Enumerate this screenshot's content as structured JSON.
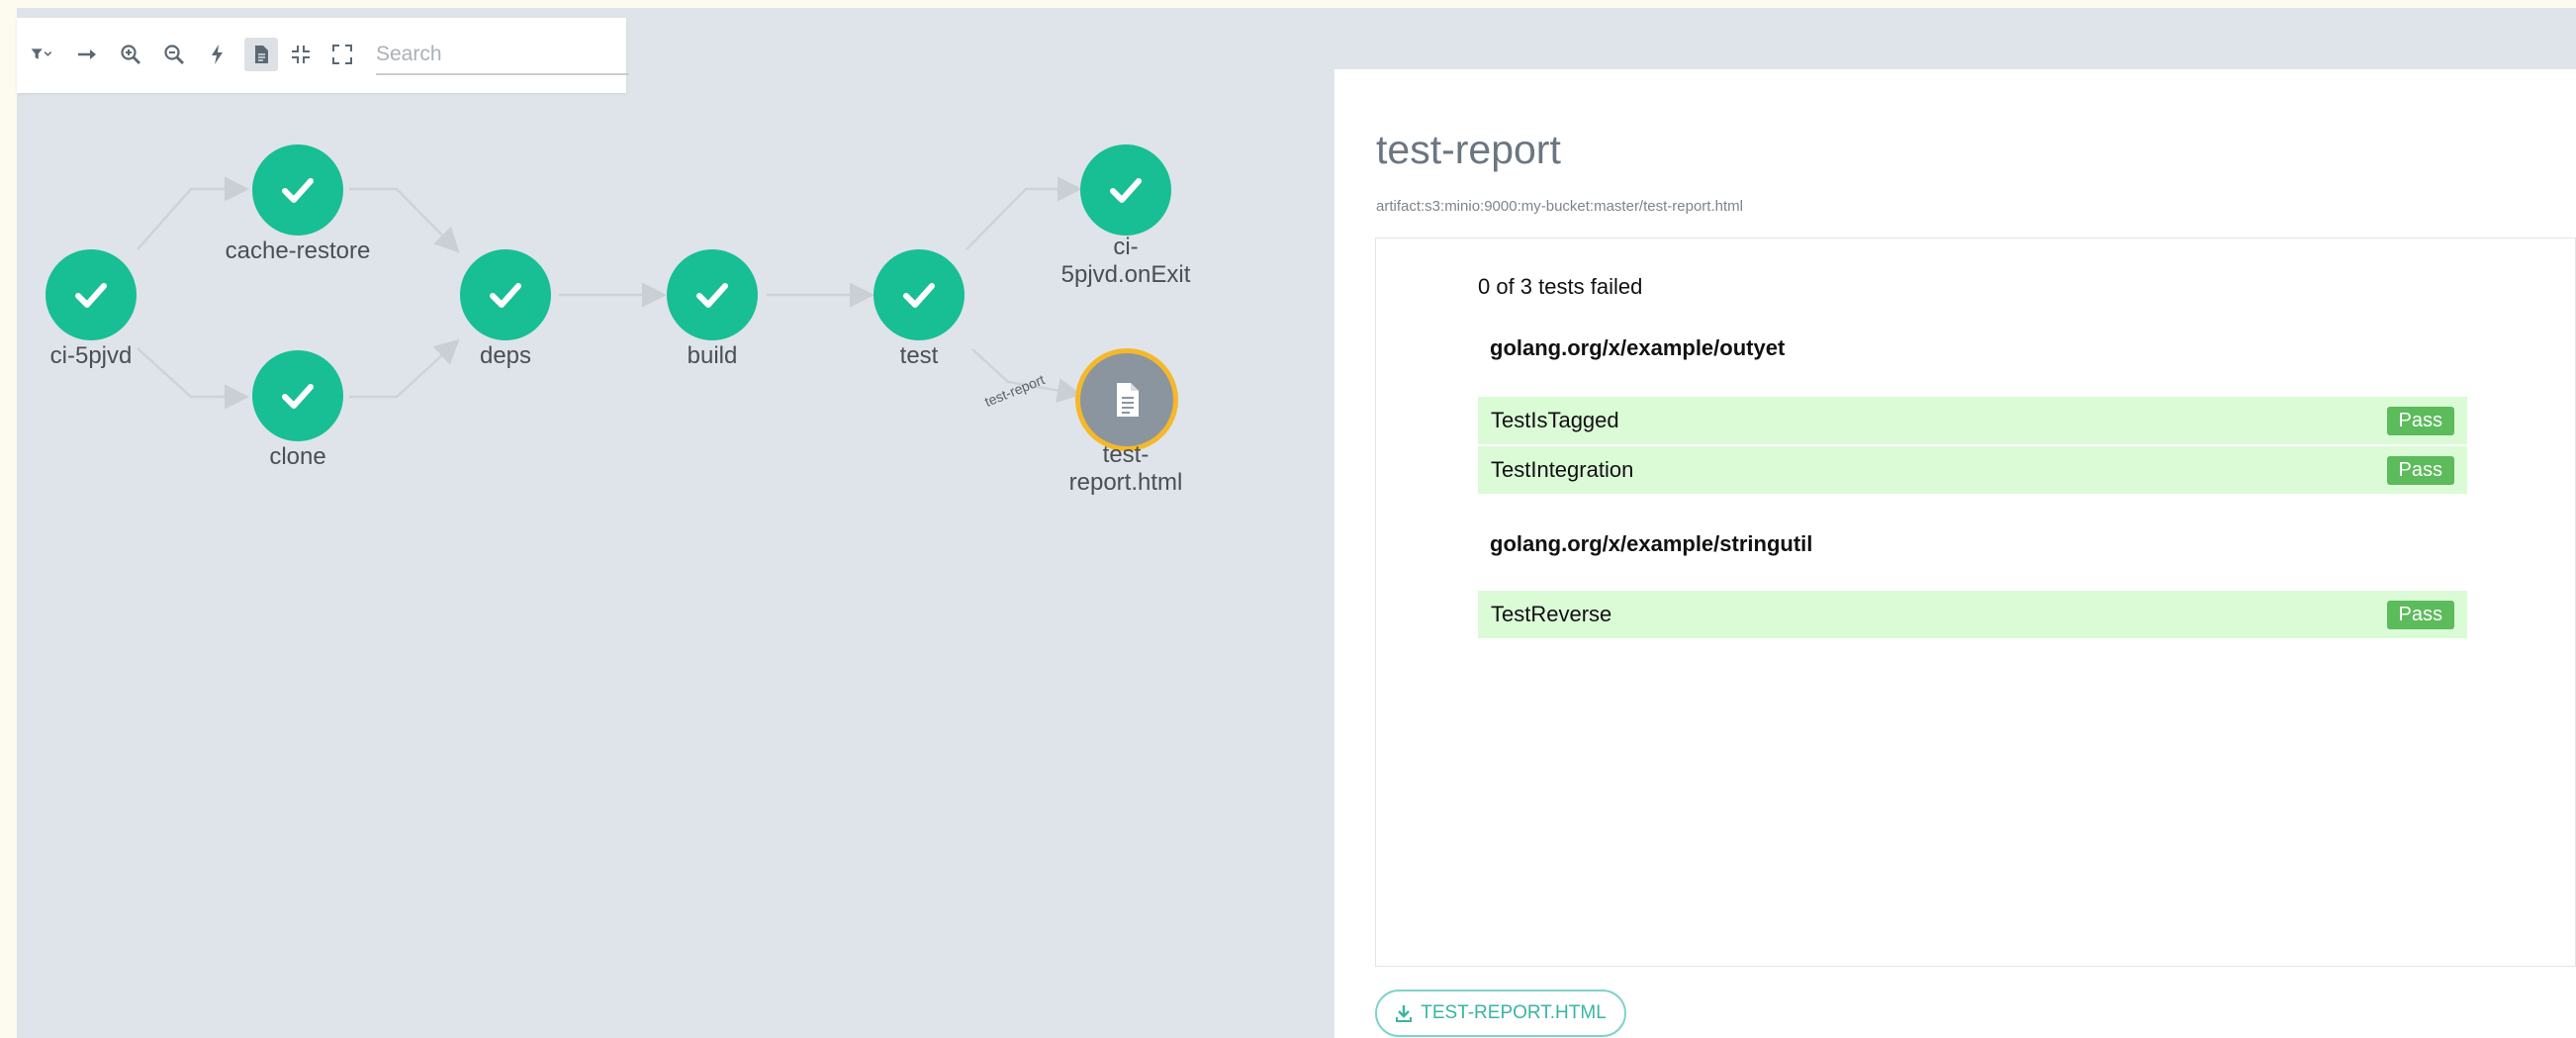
{
  "toolbar": {
    "search_placeholder": "Search",
    "buttons": [
      "filter-dropdown",
      "direction",
      "zoom-in",
      "zoom-out",
      "fast",
      "show-artifacts",
      "collapse",
      "fullscreen"
    ]
  },
  "graph": {
    "nodes": [
      {
        "id": "ci-5pjvd",
        "label": "ci-5pjvd",
        "status": "succeeded"
      },
      {
        "id": "cache-restore",
        "label": "cache-restore",
        "status": "succeeded"
      },
      {
        "id": "clone",
        "label": "clone",
        "status": "succeeded"
      },
      {
        "id": "deps",
        "label": "deps",
        "status": "succeeded"
      },
      {
        "id": "build",
        "label": "build",
        "status": "succeeded"
      },
      {
        "id": "test",
        "label": "test",
        "status": "succeeded"
      },
      {
        "id": "onexit",
        "label_line1": "ci-",
        "label_line2": "5pjvd.onExit",
        "status": "succeeded"
      },
      {
        "id": "artifact",
        "label_line1": "test-",
        "label_line2": "report.html",
        "status": "artifact"
      }
    ],
    "edge_label": "test-report"
  },
  "panel": {
    "title": "test-report",
    "artifact_path": "artifact:s3:minio:9000:my-bucket:master/test-report.html",
    "report": {
      "summary": "0 of 3 tests failed",
      "packages": [
        {
          "name": "golang.org/x/example/outyet",
          "tests": [
            {
              "name": "TestIsTagged",
              "result": "Pass"
            },
            {
              "name": "TestIntegration",
              "result": "Pass"
            }
          ]
        },
        {
          "name": "golang.org/x/example/stringutil",
          "tests": [
            {
              "name": "TestReverse",
              "result": "Pass"
            }
          ]
        }
      ]
    },
    "download_label": "TEST-REPORT.HTML"
  },
  "colors": {
    "success": "#18be94",
    "artifact": "#8a95a0",
    "artifact_ring": "#f5b82a",
    "pass": "#5cbb5b",
    "row_bg": "#dbfbd7",
    "accent": "#39b5a2"
  }
}
